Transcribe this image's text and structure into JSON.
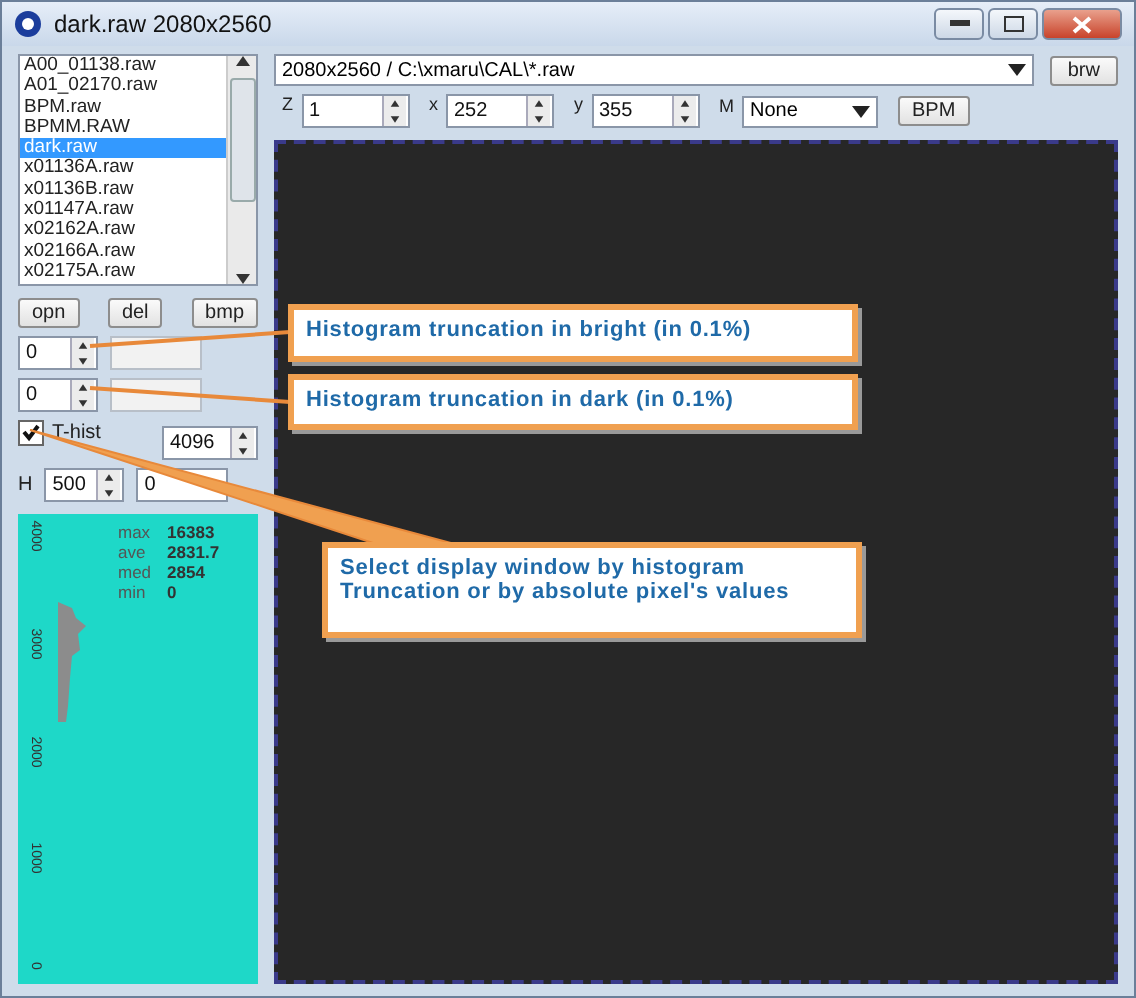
{
  "window": {
    "title": "dark.raw 2080x2560"
  },
  "file_list": {
    "items": [
      {
        "label": "A00_01138.raw",
        "selected": false
      },
      {
        "label": "A01_02170.raw",
        "selected": false
      },
      {
        "label": "BPM.raw",
        "selected": false
      },
      {
        "label": "BPMM.RAW",
        "selected": false
      },
      {
        "label": "dark.raw",
        "selected": true
      },
      {
        "label": "x01136A.raw",
        "selected": false
      },
      {
        "label": "x01136B.raw",
        "selected": false
      },
      {
        "label": "x01147A.raw",
        "selected": false
      },
      {
        "label": "x02162A.raw",
        "selected": false
      },
      {
        "label": "x02166A.raw",
        "selected": false
      },
      {
        "label": "x02175A.raw",
        "selected": false
      }
    ]
  },
  "file_buttons": [
    "opn",
    "del",
    "bmp"
  ],
  "truncation_bright": {
    "value": "0"
  },
  "truncation_dark": {
    "value": "0"
  },
  "t_hist": {
    "label": "T-hist",
    "checked": true
  },
  "range_max": {
    "value": "4096"
  },
  "height": {
    "label": "H",
    "value": "500"
  },
  "range_min": {
    "value": "0"
  },
  "histogram": {
    "axis_labels": [
      "4000",
      "3000",
      "2000",
      "1000",
      "0"
    ],
    "stats": [
      {
        "label": "max",
        "value": "16383"
      },
      {
        "label": "ave",
        "value": "2831.7"
      },
      {
        "label": "med",
        "value": "2854"
      },
      {
        "label": "min",
        "value": "0"
      }
    ]
  },
  "path_combo": {
    "value": "2080x2560 / C:\\xmaru\\CAL\\*.raw"
  },
  "browse_button": "brw",
  "controls": [
    {
      "label": "Z",
      "value": "1",
      "kind": "spin"
    },
    {
      "label": "x",
      "value": "252",
      "kind": "spin"
    },
    {
      "label": "y",
      "value": "355",
      "kind": "spin"
    },
    {
      "label": "M",
      "value": "None",
      "kind": "combo"
    }
  ],
  "bpm_button": "BPM",
  "callouts": [
    "Histogram truncation  in bright (in 0.1%)",
    "Histogram truncation  in dark (in 0.1%)",
    "Select display window by histogram Truncation or by absolute pixel's values"
  ]
}
